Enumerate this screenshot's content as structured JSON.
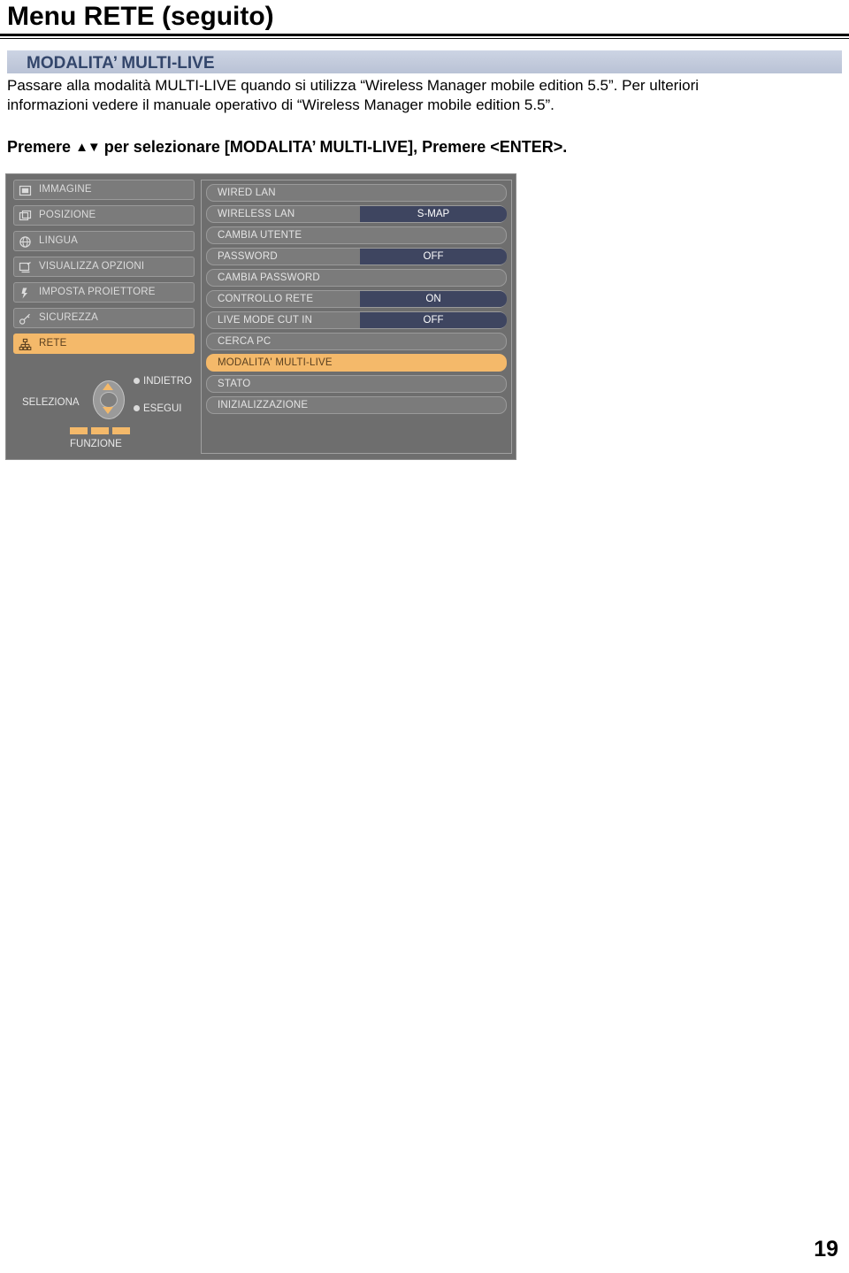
{
  "header": {
    "title": "Menu RETE (seguito)"
  },
  "section": {
    "title": "MODALITA’ MULTI-LIVE"
  },
  "body": {
    "paragraph_line1": "Passare alla modalità MULTI-LIVE quando si utilizza “Wireless Manager mobile edition 5.5”. Per ulteriori",
    "paragraph_line2": "informazioni vedere il manuale operativo di “Wireless Manager mobile edition 5.5”.",
    "instruction_prefix": "Premere",
    "instruction_arrows": "▲▼",
    "instruction_suffix": "per selezionare [MODALITA’ MULTI-LIVE], Premere <ENTER>."
  },
  "osd": {
    "menu_items": [
      {
        "label": "IMMAGINE",
        "icon": "picture-icon",
        "selected": false
      },
      {
        "label": "POSIZIONE",
        "icon": "position-icon",
        "selected": false
      },
      {
        "label": "LINGUA",
        "icon": "globe-icon",
        "selected": false
      },
      {
        "label": "VISUALIZZA OPZIONI",
        "icon": "display-options-icon",
        "selected": false
      },
      {
        "label": "IMPOSTA PROIETTORE",
        "icon": "projector-setup-icon",
        "selected": false
      },
      {
        "label": "SICUREZZA",
        "icon": "key-icon",
        "selected": false
      },
      {
        "label": "RETE",
        "icon": "network-icon",
        "selected": true
      }
    ],
    "options": [
      {
        "label": "WIRED LAN",
        "value": "",
        "highlight": false
      },
      {
        "label": "WIRELESS LAN",
        "value": "S-MAP",
        "highlight": false
      },
      {
        "label": "CAMBIA UTENTE",
        "value": "",
        "highlight": false
      },
      {
        "label": "PASSWORD",
        "value": "OFF",
        "highlight": false
      },
      {
        "label": "CAMBIA PASSWORD",
        "value": "",
        "highlight": false
      },
      {
        "label": "CONTROLLO RETE",
        "value": "ON",
        "highlight": false
      },
      {
        "label": "LIVE MODE CUT IN",
        "value": "OFF",
        "highlight": false
      },
      {
        "label": "CERCA PC",
        "value": "",
        "highlight": false
      },
      {
        "label": "MODALITA' MULTI-LIVE",
        "value": "",
        "highlight": true
      },
      {
        "label": "STATO",
        "value": "",
        "highlight": false
      },
      {
        "label": "INIZIALIZZAZIONE",
        "value": "",
        "highlight": false
      }
    ],
    "remote": {
      "select_label": "SELEZIONA",
      "back_label": "INDIETRO",
      "enter_label": "ESEGUI",
      "function_label": "FUNZIONE"
    }
  },
  "footer": {
    "page_number": "19"
  },
  "colors": {
    "section_bar_text": "#33466b",
    "highlight": "#f4b96a",
    "osd_background": "#6e6e6e",
    "value_chip": "#3e4560"
  }
}
